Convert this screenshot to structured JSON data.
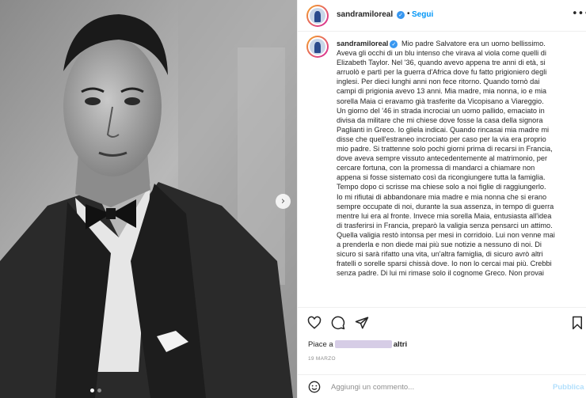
{
  "post": {
    "username": "sandramiloreal",
    "follow_label": "Segui",
    "separator": "•",
    "more_icon": "more-icon",
    "next_icon": "›",
    "caption_lines": [
      "Mio padre Salvatore era un uomo bellissimo.",
      "Aveva gli occhi di un blu intenso che virava al viola come quelli di",
      "Elizabeth Taylor. Nel '36, quando avevo appena tre anni di età, si",
      "arruolò e partì per la guerra d'Africa dove fu fatto prigioniero degli",
      "inglesi. Per dieci lunghi anni non fece ritorno. Quando tornò dai",
      "campi di prigionia avevo 13 anni. Mia madre, mia nonna, io e mia",
      "sorella Maia ci eravamo già trasferite da Vicopisano a Viareggio.",
      "Un giorno del '46 in strada incrociai un uomo pallido, emaciato in",
      "divisa da militare che mi chiese dove fosse la casa della signora",
      "Paglianti in Greco. Io gliela indicai. Quando rincasai mia madre mi",
      "disse che quell'estraneo incrociato per caso per la via era proprio",
      "mio padre. Si trattenne solo pochi giorni prima di recarsi in Francia,",
      "dove aveva sempre vissuto antecedentemente al matrimonio, per",
      "cercare fortuna, con la promessa di mandarci a chiamare non",
      "appena si fosse sistemato così da ricongiungere tutta la famiglia.",
      "Tempo dopo ci scrisse ma chiese solo a noi figlie di raggiungerlo.",
      "Io mi rifiutai di abbandonare mia madre e mia nonna che si erano",
      "sempre occupate di noi, durante la sua assenza, in tempo di guerra",
      "mentre lui era al fronte. Invece mia sorella Maia, entusiasta all'idea",
      "di trasferirsi in Francia, preparò la valigia senza pensarci un attimo.",
      "Quella valigia restò intonsa per mesi in corridoio. Lui non venne mai",
      "a prenderla e non diede mai più sue notizie a nessuno di noi. Di",
      "sicuro si sarà rifatto una vita, un'altra famiglia, di sicuro avrò altri",
      "fratelli o sorelle sparsi chissà dove. Io non lo cercai mai più. Crebbi",
      "senza padre. Di lui mi rimase solo il cognome Greco. Non provai"
    ],
    "likes_prefix": "Piace a",
    "likes_suffix": "altri",
    "date": "19 MARZO",
    "comment_placeholder": "Aggiungi un commento...",
    "publish_label": "Pubblica"
  },
  "carousel": {
    "slide_count": 2,
    "active_index": 0
  },
  "colors": {
    "accent": "#0095f6",
    "verified": "#3897f0",
    "publish_disabled": "#b2dffc",
    "border": "#efefef"
  }
}
